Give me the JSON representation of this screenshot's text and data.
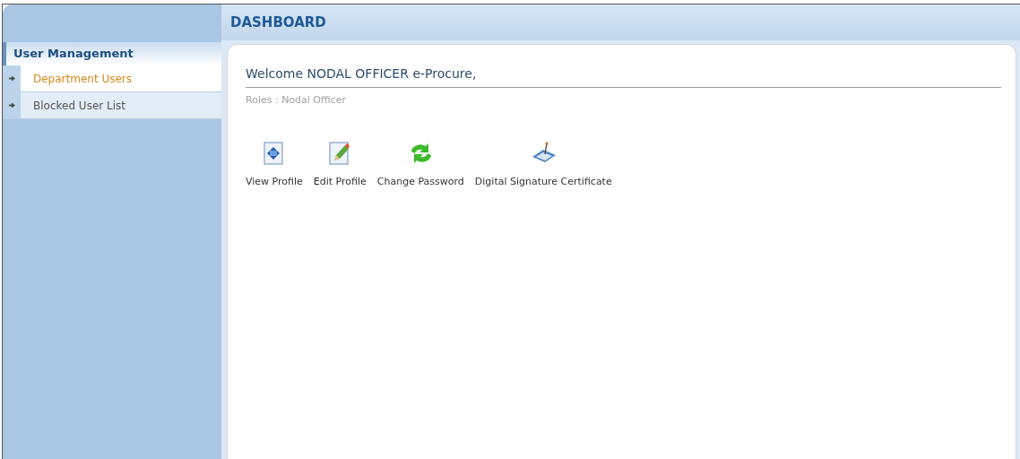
{
  "header": {
    "title": "DASHBOARD"
  },
  "sidebar": {
    "heading": "User Management",
    "items": [
      {
        "label": "Department Users",
        "selected": true
      },
      {
        "label": "Blocked User List",
        "selected": false
      }
    ]
  },
  "welcome": {
    "title": "Welcome NODAL OFFICER e-Procure,",
    "roles": "Roles : Nodal Officer"
  },
  "shortcuts": [
    "View Profile",
    "Edit Profile",
    "Change Password",
    "Digital Signature Certificate"
  ]
}
